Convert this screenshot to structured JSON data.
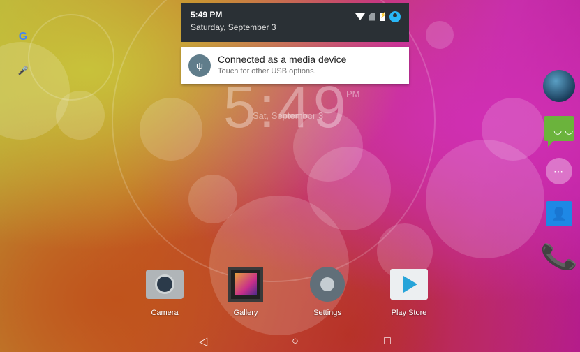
{
  "statusbar": {
    "time": "5:49 PM",
    "date": "Saturday, September 3",
    "icons": [
      "wifi-icon",
      "no-sim-icon",
      "battery-charging-icon",
      "user-icon"
    ]
  },
  "notification": {
    "icon": "usb-icon",
    "icon_glyph": "ψ",
    "title": "Connected as a media device",
    "text": "Touch for other USB options."
  },
  "clock": {
    "time": "5:49",
    "ampm": "PM",
    "date": "Sat, September 3"
  },
  "search": {
    "google_glyph": "G",
    "mic_glyph": "🎤"
  },
  "dock_right": [
    {
      "name": "browser",
      "icon": "globe-icon"
    },
    {
      "name": "messaging",
      "icon": "message-icon",
      "glyph": "◡ ◡"
    },
    {
      "name": "all-apps",
      "icon": "app-drawer-icon",
      "glyph": "⋯"
    },
    {
      "name": "contacts",
      "icon": "contacts-icon",
      "glyph": "👤"
    },
    {
      "name": "phone",
      "icon": "phone-icon",
      "glyph": "📞"
    }
  ],
  "apps": [
    {
      "label": "Camera"
    },
    {
      "label": "Gallery"
    },
    {
      "label": "Settings"
    },
    {
      "label": "Play Store"
    }
  ],
  "nav": {
    "back": "◁",
    "home": "○",
    "recents": "□"
  },
  "colors": {
    "shade_bg": "#2a3035",
    "accent": "#29b6f6",
    "notif_icon_bg": "#607d8b"
  }
}
